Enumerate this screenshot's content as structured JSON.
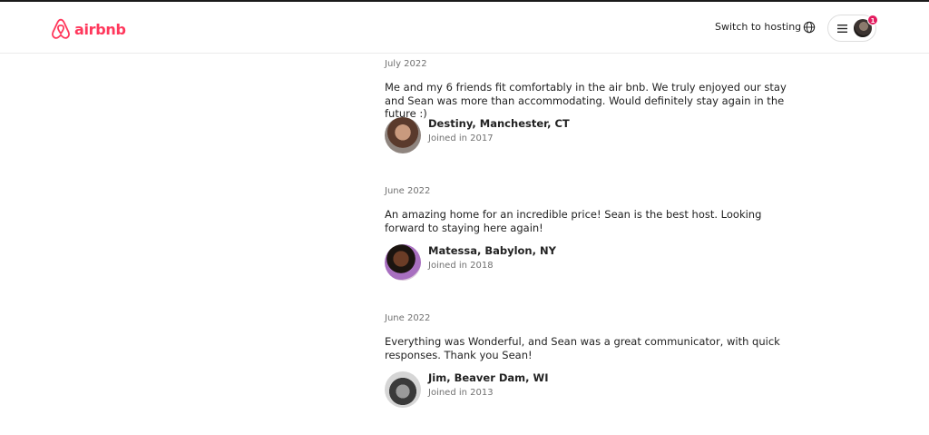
{
  "header": {
    "brand": "airbnb",
    "host_link": "Switch to hosting",
    "notification_count": "1"
  },
  "reviews": [
    {
      "date": "July 2022",
      "text": "Me and my 6 friends fit comfortably in the air bnb. We truly enjoyed our stay and Sean was more than accommodating. Would definitely stay again in the future :)",
      "name": "Destiny, Manchester, CT",
      "joined": "Joined in 2017"
    },
    {
      "date": "June 2022",
      "text": "An amazing home for an incredible price! Sean is the best host. Looking forward to staying here again!",
      "name": "Matessa, Babylon, NY",
      "joined": "Joined in 2018"
    },
    {
      "date": "June 2022",
      "text": "Everything was Wonderful, and Sean was a great communicator, with quick responses. Thank you Sean!",
      "name": "Jim, Beaver Dam, WI",
      "joined": "Joined in 2013"
    }
  ],
  "colors": {
    "brand": "#ff385c",
    "text": "#222222",
    "muted": "#717171",
    "badge": "#e31c5f"
  }
}
